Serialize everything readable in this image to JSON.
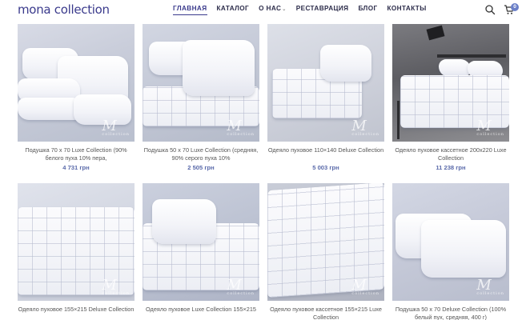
{
  "brand": {
    "logo": "mona collection"
  },
  "nav": {
    "items": [
      {
        "label": "ГЛАВНАЯ",
        "active": true
      },
      {
        "label": "КАТАЛОГ",
        "active": false
      },
      {
        "label": "О НАС",
        "active": false,
        "has_dropdown": true
      },
      {
        "label": "РЕСТАВРАЦИЯ",
        "active": false
      },
      {
        "label": "БЛОГ",
        "active": false
      },
      {
        "label": "КОНТАКТЫ",
        "active": false
      }
    ]
  },
  "header_icons": {
    "search": "search-icon",
    "cart": "cart-icon",
    "cart_count": "0"
  },
  "watermark": {
    "letter": "M",
    "sub": "collection"
  },
  "products": [
    {
      "title": "Подушка 70 х 70 Luxe Collection (90% белого пуха 10% пера,",
      "price": "4 731 грн"
    },
    {
      "title": "Подушка 50 х 70 Luxe Collection (средняя, 90% серого пуха 10%",
      "price": "2 505 грн"
    },
    {
      "title": "Одеяло пуховое 110×140 Deluxe Collection",
      "price": "5 003 грн"
    },
    {
      "title": "Одеяло пуховое кассетное 200х220 Luxe Collection",
      "price": "11 238 грн"
    },
    {
      "title": "Одеяло пуховое 155×215 Deluxe Collection",
      "price": ""
    },
    {
      "title": "Одеяло пуховое Luxe Collection 155×215",
      "price": ""
    },
    {
      "title": "Одеяло пуховое кассетное 155×215 Luxe Collection",
      "price": ""
    },
    {
      "title": "Подушка 50 х 70 Deluxe Collection (100% белый пух, средняя, 400 г)",
      "price": ""
    }
  ],
  "colors": {
    "brand": "#3a3a8c",
    "price": "#5a6aaa",
    "badge": "#6a7fc8"
  }
}
